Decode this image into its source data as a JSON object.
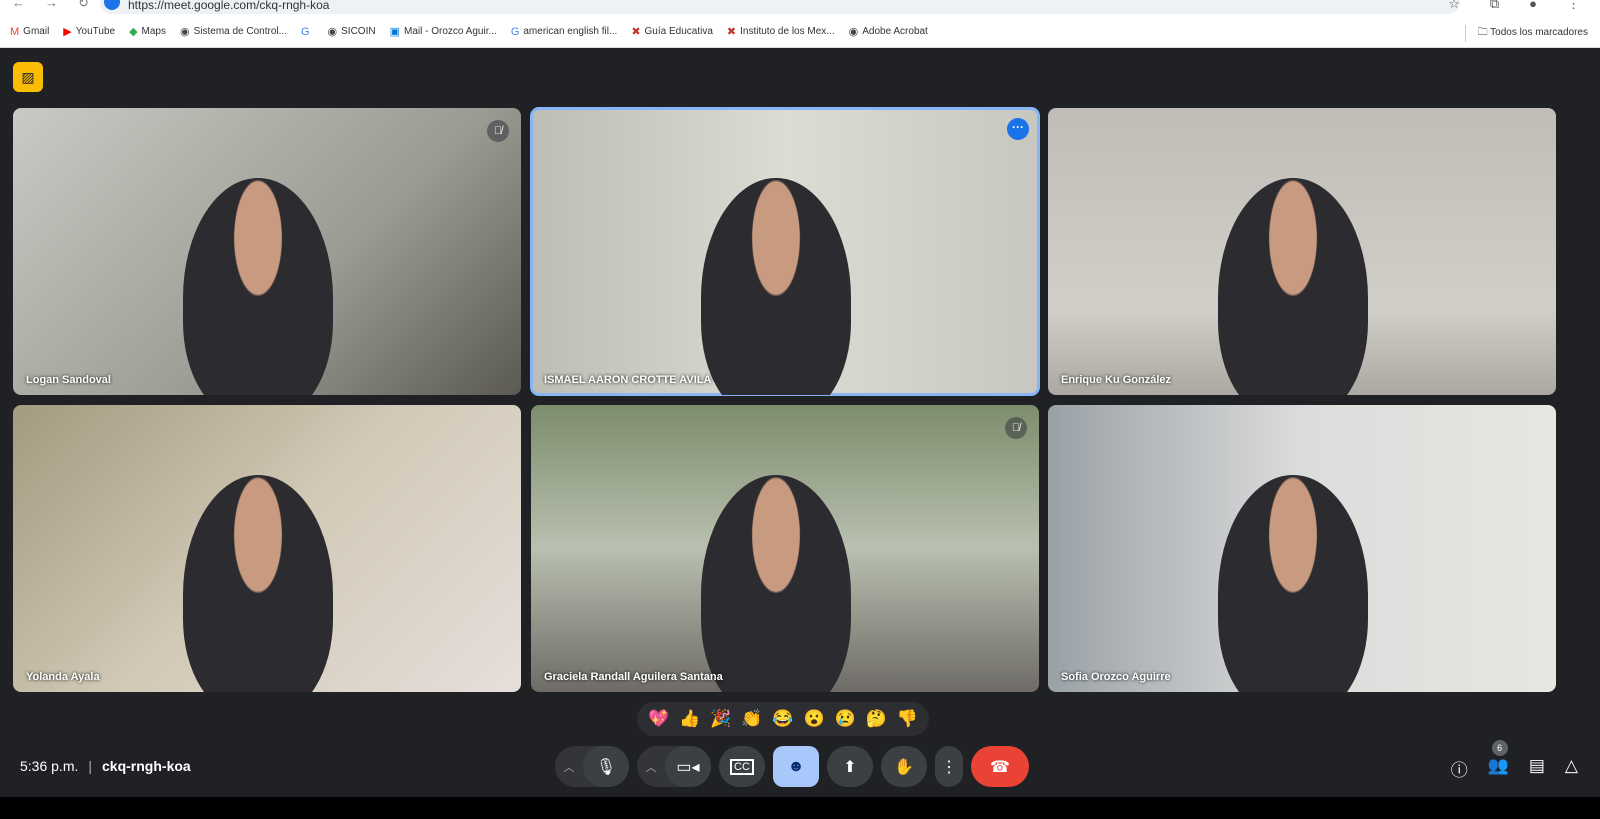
{
  "browser": {
    "url": "https://meet.google.com/ckq-rngh-koa",
    "bookmarks": [
      {
        "icon": "gmail-icon",
        "label": "Gmail",
        "glyph": "M",
        "color": "#ea4335"
      },
      {
        "icon": "youtube-icon",
        "label": "YouTube",
        "glyph": "▶",
        "color": "#ff0000"
      },
      {
        "icon": "maps-icon",
        "label": "Maps",
        "glyph": "◆",
        "color": "#34a853"
      },
      {
        "icon": "globe-icon",
        "label": "Sistema de Control...",
        "glyph": "◉",
        "color": "#444"
      },
      {
        "icon": "google-icon",
        "label": "",
        "glyph": "G",
        "color": "#4285f4"
      },
      {
        "icon": "globe-icon",
        "label": "SICOIN",
        "glyph": "◉",
        "color": "#444"
      },
      {
        "icon": "outlook-icon",
        "label": "Mail - Orozco Aguir...",
        "glyph": "▣",
        "color": "#0078d4"
      },
      {
        "icon": "google-icon",
        "label": "american english fil...",
        "glyph": "G",
        "color": "#4285f4"
      },
      {
        "icon": "flag-icon",
        "label": "Guía Educativa",
        "glyph": "✖",
        "color": "#c0392b"
      },
      {
        "icon": "flag-icon",
        "label": "Instituto de los Mex...",
        "glyph": "✖",
        "color": "#c0392b"
      },
      {
        "icon": "globe-icon",
        "label": "Adobe Acrobat",
        "glyph": "◉",
        "color": "#444"
      }
    ],
    "all_bookmarks": "Todos los marcadores"
  },
  "participants": [
    {
      "name": "Logan Sandoval",
      "muted": true,
      "bg": "linear-gradient(135deg,#c9cac4,#9a9b92 60%,#5b5a52)"
    },
    {
      "name": "ISMAEL AARON CROTTE AVILA",
      "active": true,
      "bg": "linear-gradient(90deg,#bdbdb5,#dcdcd4 50%,#c7c7bf)"
    },
    {
      "name": "Enrique Ku González",
      "bg": "linear-gradient(180deg,#bfbdb6,#d1cfc8 70%,#aaa8a0)"
    },
    {
      "name": "Yolanda Ayala",
      "bg": "linear-gradient(135deg,#a39a80,#d2c9b7 50%,#e6dfdb)"
    },
    {
      "name": "Graciela Randall Aguilera Santana",
      "muted": true,
      "bg": "linear-gradient(180deg,#7c8d6c,#b9c0b0 50%,#6e6b66)"
    },
    {
      "name": "Sofia Orozco Aguirre",
      "bg": "linear-gradient(90deg,#9aa1a6,#dcdcdc 50%,#e8e6e1)"
    }
  ],
  "reactions": [
    "💖",
    "👍",
    "🎉",
    "👏",
    "😂",
    "😮",
    "😢",
    "🤔",
    "👎"
  ],
  "meeting": {
    "time": "5:36 p.m.",
    "separator": "|",
    "code": "ckq-rngh-koa",
    "participant_count": "6"
  }
}
